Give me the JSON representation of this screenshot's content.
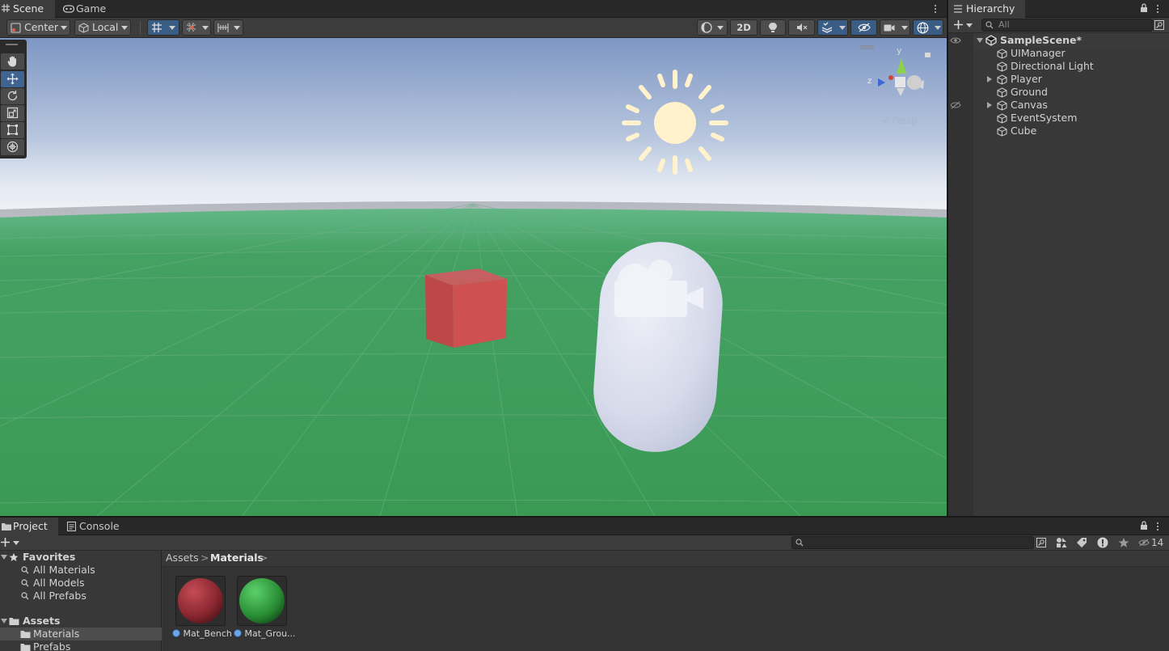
{
  "scene_window": {
    "tabs": [
      {
        "label": "Scene",
        "icon": "grid-icon",
        "active": true
      },
      {
        "label": "Game",
        "icon": "gamepad-icon",
        "active": false
      }
    ],
    "toolbar": {
      "pivot_mode": "Center",
      "pivot_rotation": "Local",
      "mode_2d": "2D"
    },
    "tools": [
      "hand-tool",
      "move-tool",
      "rotate-tool",
      "scale-tool",
      "rect-tool",
      "transform-tool"
    ],
    "active_tool": "move-tool",
    "gizmo": {
      "axis_y": "y",
      "axis_z": "z",
      "projection": "Persp"
    },
    "colors": {
      "sky_top": "#8aa0c8",
      "horizon": "#e8eef6",
      "ground": "#3a9a55",
      "cube": "#c84a4a",
      "capsule": "#d8dcea",
      "selection_blue": "#3a5d85"
    }
  },
  "hierarchy": {
    "tab_label": "Hierarchy",
    "search_placeholder": "All",
    "scene_name": "SampleScene*",
    "items": [
      {
        "name": "UIManager",
        "expandable": false
      },
      {
        "name": "Directional Light",
        "expandable": false
      },
      {
        "name": "Player",
        "expandable": true
      },
      {
        "name": "Ground",
        "expandable": false
      },
      {
        "name": "Canvas",
        "expandable": true
      },
      {
        "name": "EventSystem",
        "expandable": false
      },
      {
        "name": "Cube",
        "expandable": false
      }
    ]
  },
  "project": {
    "tabs": [
      {
        "label": "Project",
        "icon": "folder-icon",
        "active": true
      },
      {
        "label": "Console",
        "icon": "console-icon",
        "active": false
      }
    ],
    "hidden_count": "14",
    "favorites": {
      "label": "Favorites",
      "items": [
        "All Materials",
        "All Models",
        "All Prefabs"
      ]
    },
    "assets": {
      "label": "Assets",
      "folders": [
        "Materials",
        "Prefabs"
      ],
      "selected_folder": "Materials"
    },
    "breadcrumb": [
      "Assets",
      "Materials"
    ],
    "files": [
      {
        "name": "Mat_Bench",
        "color": "#9c2b34"
      },
      {
        "name": "Mat_Grou...",
        "color": "#2f9a3a"
      }
    ]
  }
}
